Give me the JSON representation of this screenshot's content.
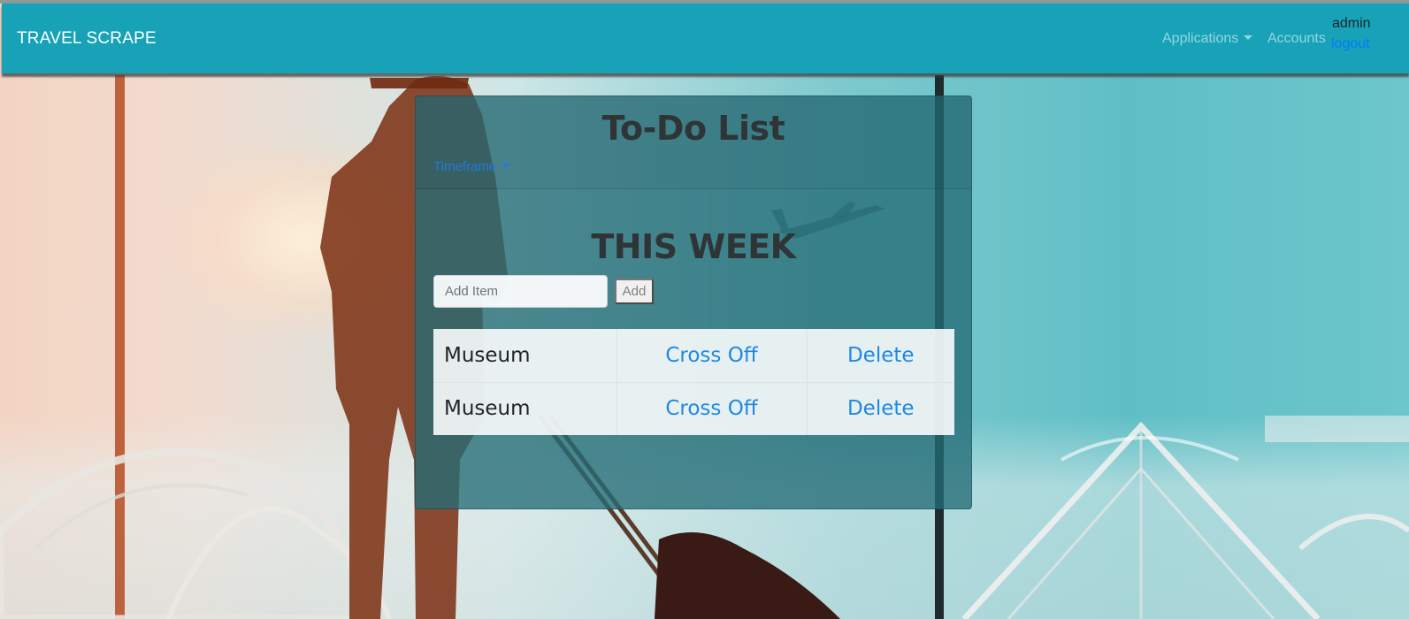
{
  "navbar": {
    "brand": "TRAVEL SCRAPE",
    "applications_label": "Applications",
    "accounts_label": "Accounts",
    "username": "admin",
    "logout_label": "logout",
    "background_color": "#17a2b8"
  },
  "card": {
    "title": "To-Do List",
    "timeframe_label": "Timeframe",
    "section_title": "THIS WEEK",
    "add_input": {
      "placeholder": "Add Item",
      "value": ""
    },
    "add_button_label": "Add",
    "items": [
      {
        "name": "Museum",
        "cross_off_label": "Cross Off",
        "delete_label": "Delete"
      },
      {
        "name": "Museum",
        "cross_off_label": "Cross Off",
        "delete_label": "Delete"
      }
    ]
  },
  "colors": {
    "link": "#1e88e5",
    "logout_link": "#007bff",
    "card_background": "#246c76"
  }
}
